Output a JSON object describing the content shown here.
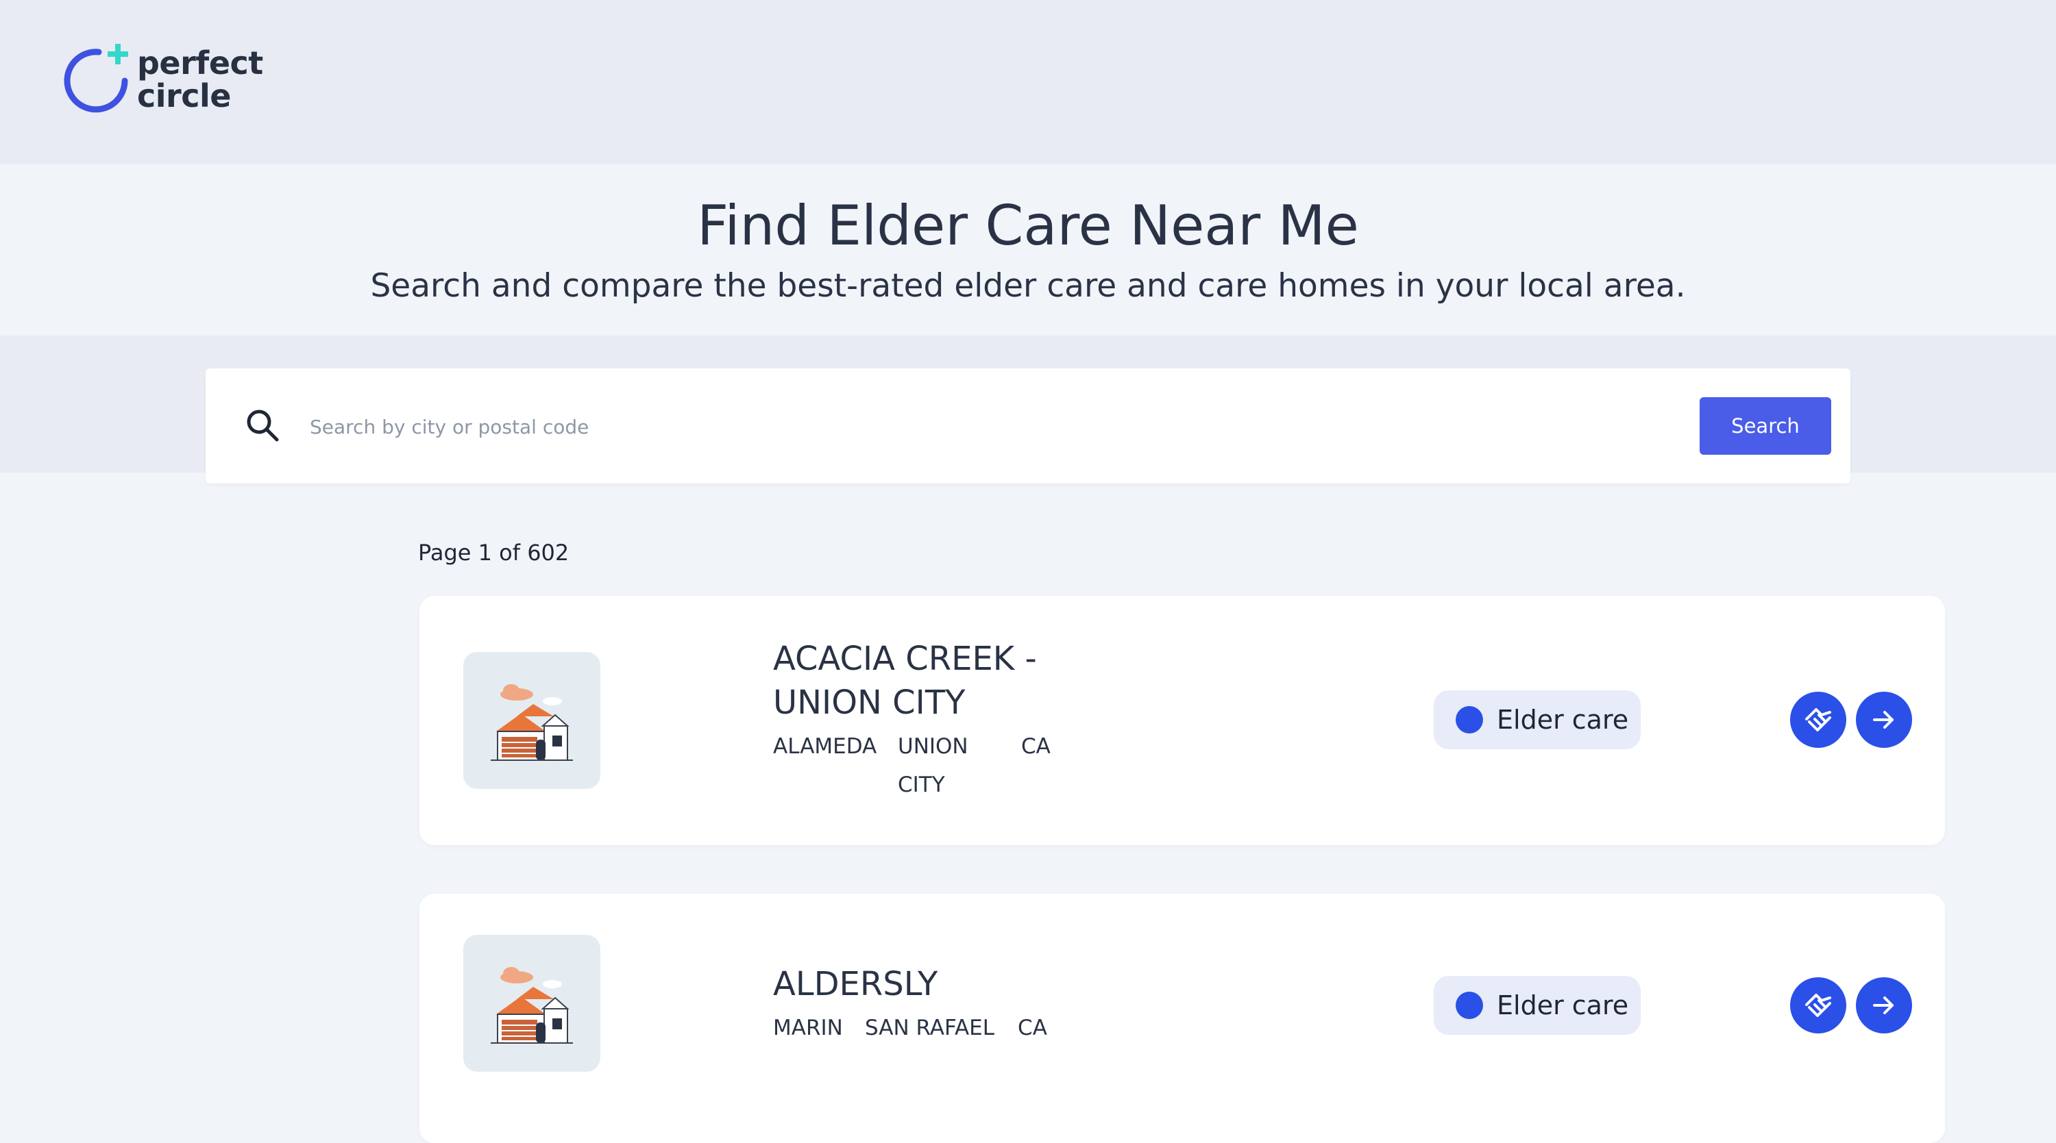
{
  "brand": {
    "name_line1": "perfect",
    "name_line2": "circle"
  },
  "hero": {
    "title": "Find Elder Care Near Me",
    "subtitle": "Search and compare the best-rated elder care and care homes in your local area."
  },
  "search": {
    "placeholder": "Search by city or postal code",
    "value": "",
    "button_label": "Search"
  },
  "pagination": {
    "label": "Page 1 of 602"
  },
  "listings": [
    {
      "name": "ACACIA CREEK - UNION CITY",
      "county": "ALAMEDA",
      "city": "UNION CITY",
      "state": "CA",
      "badge": "Elder care"
    },
    {
      "name": "ALDERSLY",
      "county": "MARIN",
      "city": "SAN RAFAEL",
      "state": "CA",
      "badge": "Elder care"
    }
  ],
  "colors": {
    "accent": "#2a50e8",
    "search_button": "#4a5de8",
    "logo_ring": "#3f51e0",
    "logo_plus": "#35d8c8",
    "header_bg": "#e8ebf3",
    "page_bg": "#f1f4f9"
  },
  "icons": {
    "logo": "perfect-circle-logo-icon",
    "search": "search-icon",
    "review": "handshake-icon",
    "details": "arrow-right-icon",
    "thumbnail": "house-icon"
  }
}
